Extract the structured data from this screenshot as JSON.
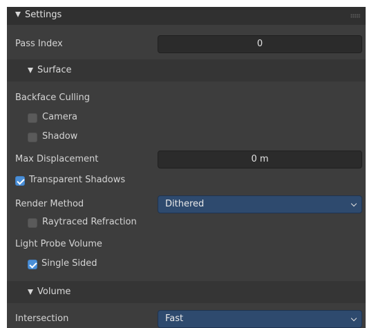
{
  "settings_panel": {
    "title": "Settings",
    "pass_index": {
      "label": "Pass Index",
      "value": "0"
    },
    "surface": {
      "title": "Surface",
      "backface_culling": {
        "label": "Backface Culling",
        "camera": {
          "label": "Camera",
          "checked": false
        },
        "shadow": {
          "label": "Shadow",
          "checked": false
        }
      },
      "max_displacement": {
        "label": "Max Displacement",
        "value": "0 m"
      },
      "transparent_shadows": {
        "label": "Transparent Shadows",
        "checked": true
      },
      "render_method": {
        "label": "Render Method",
        "value": "Dithered"
      },
      "raytraced_refraction": {
        "label": "Raytraced Refraction",
        "checked": false
      },
      "light_probe_volume": {
        "label": "Light Probe Volume",
        "single_sided": {
          "label": "Single Sided",
          "checked": true
        }
      }
    },
    "volume": {
      "title": "Volume",
      "intersection": {
        "label": "Intersection",
        "value": "Fast"
      }
    }
  },
  "colors": {
    "panel_bg": "#3d3d3d",
    "header_bg": "#303030",
    "subheader_bg": "#353535",
    "field_bg": "#2b2b2b",
    "dropdown_bg": "#2e4a6e",
    "checkbox_on": "#4a8fd8",
    "checkbox_off": "#5a5a5a",
    "text": "#d4d4d4"
  },
  "icons": {
    "expand": "disclosure-triangle-down-icon",
    "drag": "drag-grip-icon",
    "chevron": "chevron-down-icon",
    "check": "checkmark-icon"
  }
}
